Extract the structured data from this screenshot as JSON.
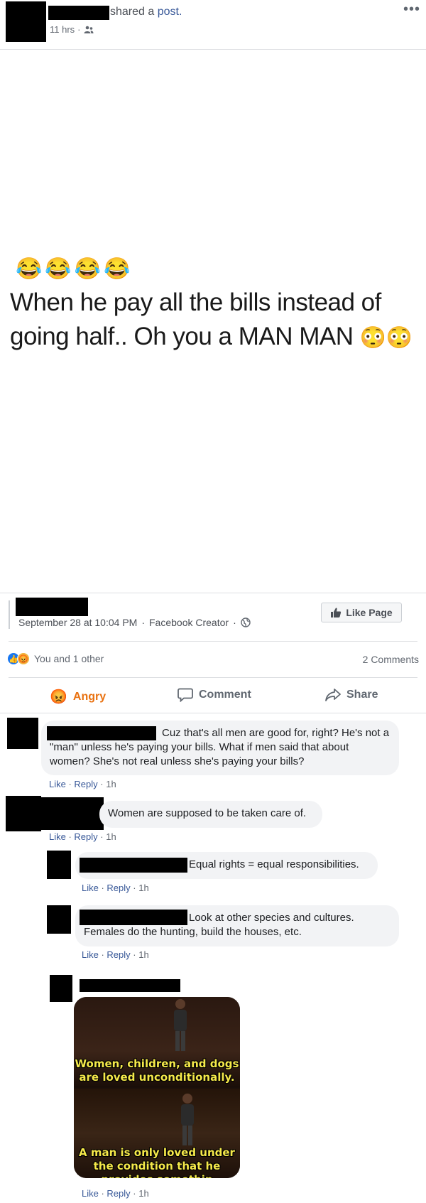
{
  "header": {
    "shared_text": "shared a ",
    "post_link": "post.",
    "time": "11 hrs",
    "more": "•••"
  },
  "post": {
    "emojis": [
      "😂",
      "😂",
      "😂",
      "😂"
    ],
    "text": "When he pay all the bills instead of going half.. Oh you a MAN MAN",
    "trailing_emojis": "😳😳"
  },
  "card": {
    "date": "September 28 at 10:04 PM",
    "source": "Facebook Creator",
    "like_page": "Like Page"
  },
  "reactions": {
    "summary": "You and 1 other",
    "comments_count": "2 Comments"
  },
  "actions": {
    "angry": "Angry",
    "comment": "Comment",
    "share": "Share"
  },
  "comments": [
    {
      "text": "Cuz that's all men are good for, right? He's not a \"man\" unless he's paying your bills. What if men said that about women? She's not real unless she's paying your bills?",
      "like": "Like",
      "reply": "Reply",
      "time": "1h"
    },
    {
      "text": "Women are supposed to be taken care of.",
      "like": "Like",
      "reply": "Reply",
      "time": "1h"
    }
  ],
  "replies": [
    {
      "text": "Equal rights = equal responsibilities.",
      "like": "Like",
      "reply": "Reply",
      "time": "1h"
    },
    {
      "text": "Look at other species and cultures. Females do the hunting, build the houses, etc.",
      "like": "Like",
      "reply": "Reply",
      "time": "1h"
    },
    {
      "like": "Like",
      "reply": "Reply",
      "time": "1h"
    }
  ],
  "meme": {
    "caption_top": "Women, children, and dogs are loved unconditionally.",
    "caption_bottom": "A man is only loved under the condition that he provides somethin"
  },
  "colors": {
    "link": "#385898",
    "angry": "#e9710f",
    "like_blue": "#1877f2",
    "bubble": "#f2f3f5",
    "meme_caption": "#f5e94a"
  }
}
